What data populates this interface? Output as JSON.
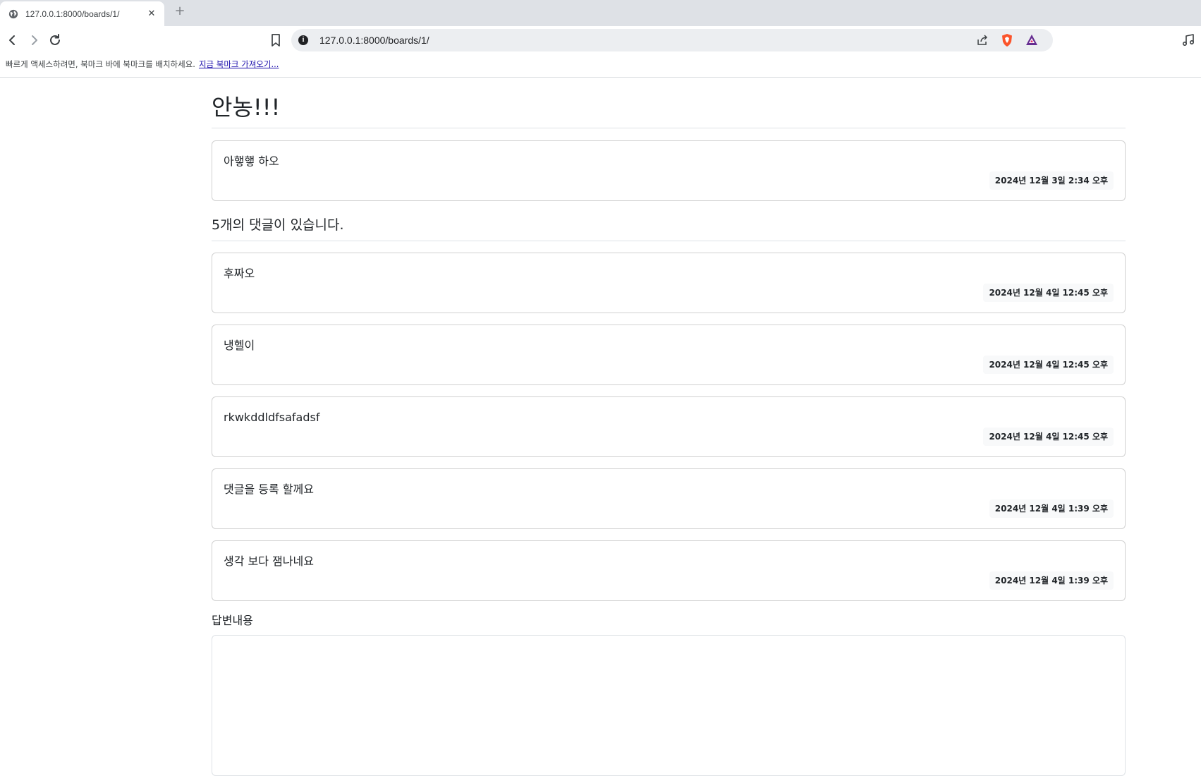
{
  "browser": {
    "tab_title": "127.0.0.1:8000/boards/1/",
    "tab_close": "✕",
    "new_tab": "+",
    "url": "127.0.0.1:8000/boards/1/",
    "bookmark_bar_text": "빠르게 액세스하려면, 북마크 바에 북마크를 배치하세요.",
    "bookmark_bar_link": "지금 북마크 가져오기...",
    "icons": [
      "globe-icon",
      "back-icon",
      "forward-icon",
      "reload-icon",
      "bookmark-icon",
      "site-info-icon",
      "share-icon",
      "brave-shields-icon",
      "brave-rewards-icon",
      "media-icon"
    ],
    "colors": {
      "brave_orange": "#fb542b",
      "rewards_purple": "#662d91"
    }
  },
  "question": {
    "subject": "안농!!!",
    "content": "아햏햏 하오",
    "date": "2024년 12월 3일 2:34 오후"
  },
  "answers": {
    "count_text": "5개의 댓글이 있습니다.",
    "items": [
      {
        "content": "후짜오",
        "date": "2024년 12월 4일 12:45 오후"
      },
      {
        "content": "냉헬이",
        "date": "2024년 12월 4일 12:45 오후"
      },
      {
        "content": "rkwkddldfsafadsf",
        "date": "2024년 12월 4일 12:45 오후"
      },
      {
        "content": "댓글을 등록 할께요",
        "date": "2024년 12월 4일 1:39 오후"
      },
      {
        "content": "생각 보다 잼나네요",
        "date": "2024년 12월 4일 1:39 오후"
      }
    ]
  },
  "form": {
    "label": "답변내용",
    "textarea_value": ""
  }
}
